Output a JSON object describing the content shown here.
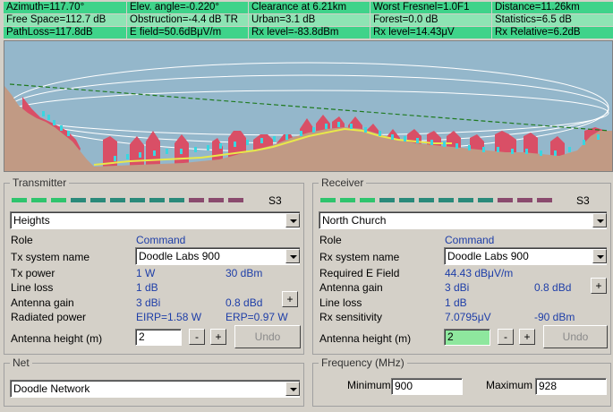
{
  "stats": {
    "row0": [
      "Azimuth=117.70°",
      "Elev. angle=-0.220°",
      "Clearance at 6.21km",
      "Worst Fresnel=1.0F1",
      "Distance=11.26km"
    ],
    "row1": [
      "Free Space=112.7 dB",
      "Obstruction=-4.4 dB TR",
      "Urban=3.1 dB",
      "Forest=0.0 dB",
      "Statistics=6.5 dB"
    ],
    "row2": [
      "PathLoss=117.8dB",
      "E field=50.6dBμV/m",
      "Rx level=-83.8dBm",
      "Rx level=14.43μV",
      "Rx Relative=6.2dB"
    ]
  },
  "colors": {
    "stats_dark": "#3fd38a",
    "stats_light": "#8ee4b4",
    "sky": "#94b7cb",
    "terrain": "#c19a84",
    "clutter": "#d94f66",
    "fresnel": "#ffffff",
    "los": "#1f7a1f",
    "value_blue": "#1e3ea8",
    "signal_green": "#2fc46d",
    "signal_teal": "#2a8a7a",
    "signal_purple": "#8a4a6e"
  },
  "transmitter": {
    "title": "Transmitter",
    "signal_label": "S3",
    "site": "Heights",
    "role_label": "Role",
    "role_value": "Command",
    "system_label": "Tx system name",
    "system_value": "Doodle Labs 900",
    "power_label": "Tx power",
    "power_w": "1 W",
    "power_dbm": "30 dBm",
    "lineloss_label": "Line loss",
    "lineloss_value": "1 dB",
    "gain_label": "Antenna gain",
    "gain_dbi": "3 dBi",
    "gain_dbd": "0.8 dBd",
    "plus": "+",
    "radiated_label": "Radiated power",
    "eirp": "EIRP=1.58 W",
    "erp": "ERP=0.97 W",
    "height_label": "Antenna height (m)",
    "height_value": "2",
    "minus": "-",
    "undo": "Undo"
  },
  "receiver": {
    "title": "Receiver",
    "signal_label": "S3",
    "site": "North Church",
    "role_label": "Role",
    "role_value": "Command",
    "system_label": "Rx system name",
    "system_value": "Doodle Labs 900",
    "efield_label": "Required E Field",
    "efield_value": "44.43 dBμV/m",
    "gain_label": "Antenna gain",
    "gain_dbi": "3 dBi",
    "gain_dbd": "0.8 dBd",
    "plus": "+",
    "lineloss_label": "Line loss",
    "lineloss_value": "1 dB",
    "sens_label": "Rx sensitivity",
    "sens_uv": "7.0795μV",
    "sens_dbm": "-90 dBm",
    "height_label": "Antenna height (m)",
    "height_value": "2",
    "minus": "-",
    "undo": "Undo"
  },
  "net": {
    "title": "Net",
    "value": "Doodle Network"
  },
  "frequency": {
    "title": "Frequency (MHz)",
    "min_label": "Minimum",
    "min_value": "900",
    "max_label": "Maximum",
    "max_value": "928"
  }
}
